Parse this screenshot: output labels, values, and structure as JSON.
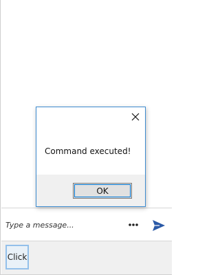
{
  "compose": {
    "placeholder": "Type a message...",
    "more_icon": "more-dots-icon",
    "send_icon": "send-arrow-icon"
  },
  "bottom": {
    "click_label": "Click"
  },
  "dialog": {
    "message": "Command executed!",
    "ok_label": "OK",
    "close_icon": "close-icon"
  },
  "colors": {
    "accent": "#2b5aa7",
    "dialog_border": "#3c8bd0",
    "button_focus": "#0078d7",
    "footer_bg": "#f0f0f0"
  }
}
